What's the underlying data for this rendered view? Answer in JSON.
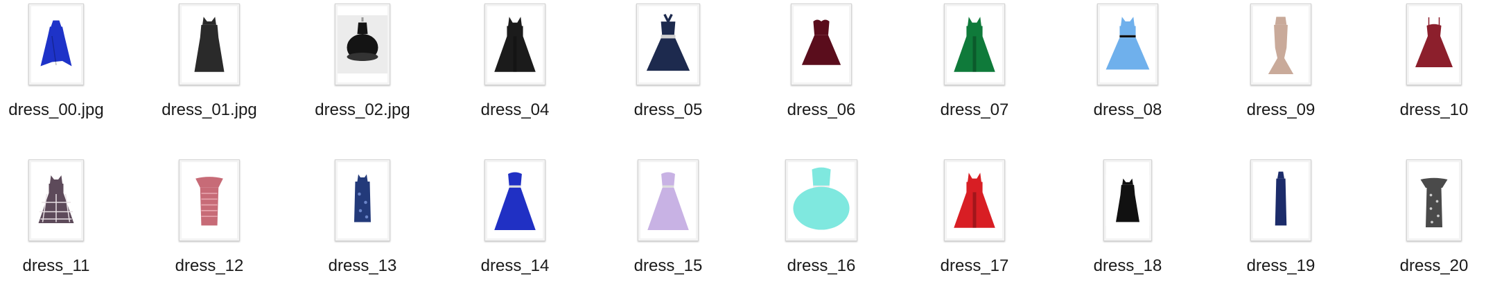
{
  "files": [
    {
      "name": "dress_00.jpg",
      "icon": "dress-thumbnail",
      "color": "#1e33c8",
      "style": "hilo",
      "bg": "#ffffff"
    },
    {
      "name": "dress_01.jpg",
      "icon": "dress-thumbnail",
      "color": "#2a2a2a",
      "style": "aline",
      "bg": "#ffffff"
    },
    {
      "name": "dress_02.jpg",
      "icon": "dress-thumbnail",
      "color": "#141414",
      "style": "tutu",
      "bg": "#ececec"
    },
    {
      "name": "dress_04",
      "icon": "dress-thumbnail",
      "color": "#1b1b1b",
      "style": "swing",
      "bg": "#ffffff"
    },
    {
      "name": "dress_05",
      "icon": "dress-thumbnail",
      "color": "#1d2a4e",
      "style": "halter",
      "bg": "#ffffff"
    },
    {
      "name": "dress_06",
      "icon": "dress-thumbnail",
      "color": "#5a0d1c",
      "style": "sweetheart",
      "bg": "#ffffff"
    },
    {
      "name": "dress_07",
      "icon": "dress-thumbnail",
      "color": "#0f7a3a",
      "style": "swing",
      "bg": "#ffffff"
    },
    {
      "name": "dress_08",
      "icon": "dress-thumbnail",
      "color": "#6fb0ec",
      "style": "belted",
      "bg": "#ffffff"
    },
    {
      "name": "dress_09",
      "icon": "dress-thumbnail",
      "color": "#c9aa9a",
      "style": "mermaid",
      "bg": "#ffffff"
    },
    {
      "name": "dress_10",
      "icon": "dress-thumbnail",
      "color": "#8c1f2c",
      "style": "strap",
      "bg": "#ffffff"
    },
    {
      "name": "dress_11",
      "icon": "dress-thumbnail",
      "color": "#5d4a5a",
      "style": "plaid",
      "bg": "#ffffff"
    },
    {
      "name": "dress_12",
      "icon": "dress-thumbnail",
      "color": "#c76b77",
      "style": "bodycon",
      "bg": "#ffffff"
    },
    {
      "name": "dress_13",
      "icon": "dress-thumbnail",
      "color": "#233a7a",
      "style": "shift",
      "bg": "#ffffff"
    },
    {
      "name": "dress_14",
      "icon": "dress-thumbnail",
      "color": "#2030c4",
      "style": "ballgown",
      "bg": "#ffffff"
    },
    {
      "name": "dress_15",
      "icon": "dress-thumbnail",
      "color": "#c8b2e4",
      "style": "ballgown",
      "bg": "#ffffff"
    },
    {
      "name": "dress_16",
      "icon": "dress-thumbnail",
      "color": "#7fe8df",
      "style": "puffy",
      "bg": "#ffffff"
    },
    {
      "name": "dress_17",
      "icon": "dress-thumbnail",
      "color": "#d81e24",
      "style": "swing",
      "bg": "#ffffff"
    },
    {
      "name": "dress_18",
      "icon": "dress-thumbnail",
      "color": "#111111",
      "style": "aline",
      "bg": "#ffffff"
    },
    {
      "name": "dress_19",
      "icon": "dress-thumbnail",
      "color": "#1c2c6a",
      "style": "maxi",
      "bg": "#ffffff"
    },
    {
      "name": "dress_20",
      "icon": "dress-thumbnail",
      "color": "#4a4a4a",
      "style": "offshoulder",
      "bg": "#ffffff"
    }
  ]
}
